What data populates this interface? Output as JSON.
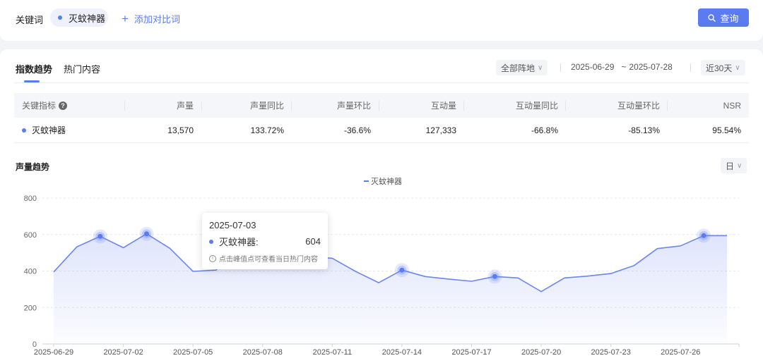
{
  "keyword_bar": {
    "label": "关键词",
    "chip": "灭蚊神器",
    "add_compare": "添加对比词",
    "query_button": "查询"
  },
  "tabs": [
    {
      "label": "指数趋势",
      "active": true
    },
    {
      "label": "热门内容",
      "active": false
    }
  ],
  "filters": {
    "region": "全部阵地",
    "date_start": "2025-06-29",
    "date_end": "2025-07-28",
    "period": "近30天"
  },
  "table": {
    "headers": [
      "关键指标",
      "声量",
      "声量同比",
      "声量环比",
      "互动量",
      "互动量同比",
      "互动量环比",
      "NSR"
    ],
    "rows": [
      [
        "灭蚊神器",
        "13,570",
        "133.72%",
        "-36.6%",
        "127,333",
        "-66.8%",
        "-85.13%",
        "95.54%"
      ]
    ]
  },
  "chart_section": {
    "title": "声量趋势",
    "granularity": "日"
  },
  "tooltip": {
    "date": "2025-07-03",
    "series_name": "灭蚊神器:",
    "value": "604",
    "hint": "点击峰值点可查看当日热门内容"
  },
  "colors": {
    "accent": "#5b7bf0",
    "line": "#6b86ee"
  },
  "chart_data": {
    "type": "area",
    "legend_placement": "top-center",
    "grid": true,
    "ylim": [
      0,
      800
    ],
    "yticks": [
      0,
      200,
      400,
      600,
      800
    ],
    "xticks": [
      "2025-06-29",
      "2025-07-02",
      "2025-07-05",
      "2025-07-08",
      "2025-07-11",
      "2025-07-14",
      "2025-07-17",
      "2025-07-20",
      "2025-07-23",
      "2025-07-26"
    ],
    "x": [
      "2025-06-29",
      "2025-06-30",
      "2025-07-01",
      "2025-07-02",
      "2025-07-03",
      "2025-07-04",
      "2025-07-05",
      "2025-07-06",
      "2025-07-07",
      "2025-07-08",
      "2025-07-09",
      "2025-07-10",
      "2025-07-11",
      "2025-07-12",
      "2025-07-13",
      "2025-07-14",
      "2025-07-15",
      "2025-07-16",
      "2025-07-17",
      "2025-07-18",
      "2025-07-19",
      "2025-07-20",
      "2025-07-21",
      "2025-07-22",
      "2025-07-23",
      "2025-07-24",
      "2025-07-25",
      "2025-07-26",
      "2025-07-27",
      "2025-07-28"
    ],
    "series": [
      {
        "name": "灭蚊神器",
        "values": [
          395,
          533,
          590,
          528,
          604,
          525,
          398,
          405,
          582,
          530,
          508,
          480,
          470,
          398,
          336,
          405,
          370,
          356,
          344,
          370,
          362,
          287,
          362,
          372,
          386,
          430,
          523,
          538,
          594,
          594
        ],
        "peaks": [
          2,
          4,
          8,
          15,
          19,
          28
        ]
      }
    ]
  }
}
